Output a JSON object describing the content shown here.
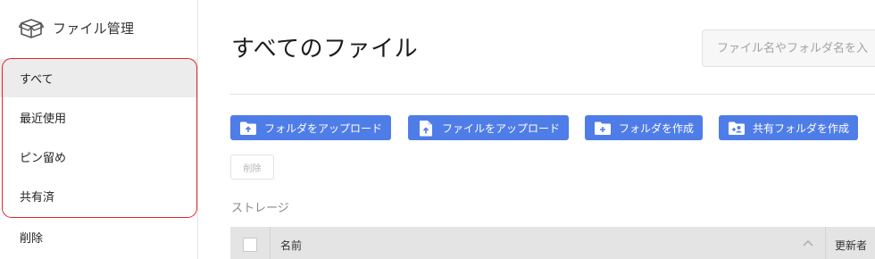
{
  "sidebar": {
    "brand_title": "ファイル管理",
    "items": [
      {
        "label": "すべて"
      },
      {
        "label": "最近使用"
      },
      {
        "label": "ピン留め"
      },
      {
        "label": "共有済"
      },
      {
        "label": "削除"
      }
    ]
  },
  "main": {
    "title": "すべてのファイル",
    "search_placeholder": "ファイル名やフォルダ名を入",
    "buttons": {
      "upload_folder": "フォルダをアップロード",
      "upload_file": "ファイルをアップロード",
      "create_folder": "フォルダを作成",
      "create_shared_folder": "共有フォルダを作成",
      "delete": "削除"
    },
    "section_label": "ストレージ",
    "table": {
      "columns": [
        "名前",
        "更新者"
      ]
    }
  },
  "colors": {
    "accent": "#4f7de8",
    "highlight_border": "#e0262b",
    "active_bg": "#ececec"
  }
}
